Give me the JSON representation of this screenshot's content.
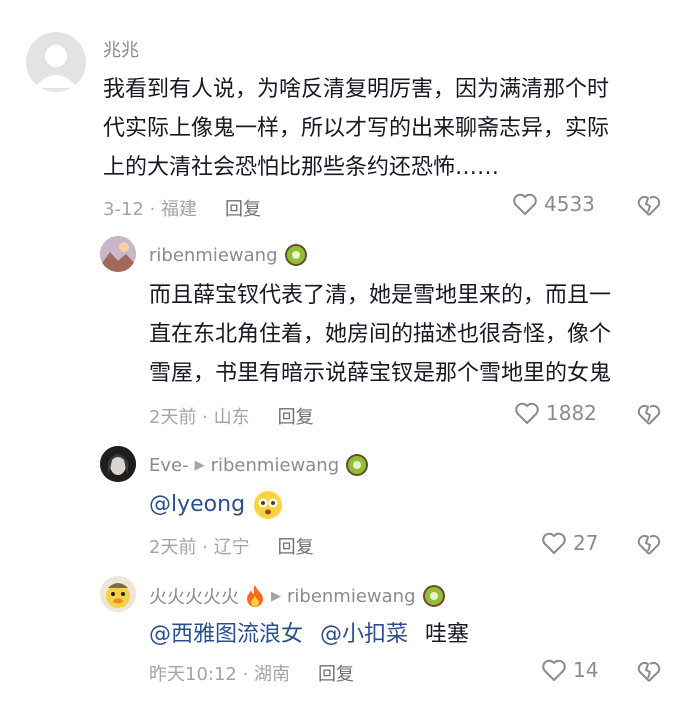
{
  "comments": [
    {
      "username": "兆兆",
      "text_lines": [
        "我看到有人说，为啥反清复明厉害，因为满清那个时",
        "代实际上像鬼一样，所以才写的出来聊斋志异，实际",
        "上的大清社会恐怕比那些条约还恐怖……"
      ],
      "date_location": "3-12 · 福建",
      "reply_label": "回复",
      "likes": "4533"
    },
    {
      "username": "ribenmiewang",
      "badge_icon": "kiwi-icon",
      "text_lines": [
        "而且薛宝钗代表了清，她是雪地里来的，而且一",
        "直在东北角住着，她房间的描述也很奇怪，像个",
        "雪屋，书里有暗示说薛宝钗是那个雪地里的女鬼"
      ],
      "date_location": "2天前 · 山东",
      "reply_label": "回复",
      "likes": "1882"
    },
    {
      "username": "Eve-",
      "reply_to": "ribenmiewang",
      "badge_icon": "kiwi-icon",
      "mention": "@lyeong",
      "emoji": "flushed-face-icon",
      "date_location": "2天前 · 辽宁",
      "reply_label": "回复",
      "likes": "27"
    },
    {
      "username": "火火火火火",
      "name_emoji": "fire-icon",
      "reply_to": "ribenmiewang",
      "badge_icon": "kiwi-icon",
      "mention_1": "@西雅图流浪女",
      "mention_2": "@小扣菜",
      "trailing_text": "哇塞",
      "date_location": "昨天10:12 · 湖南",
      "reply_label": "回复",
      "likes": "14"
    }
  ],
  "colors": {
    "text": "#161823",
    "meta": "#a3a4a8",
    "mention": "#2b4f8c"
  }
}
